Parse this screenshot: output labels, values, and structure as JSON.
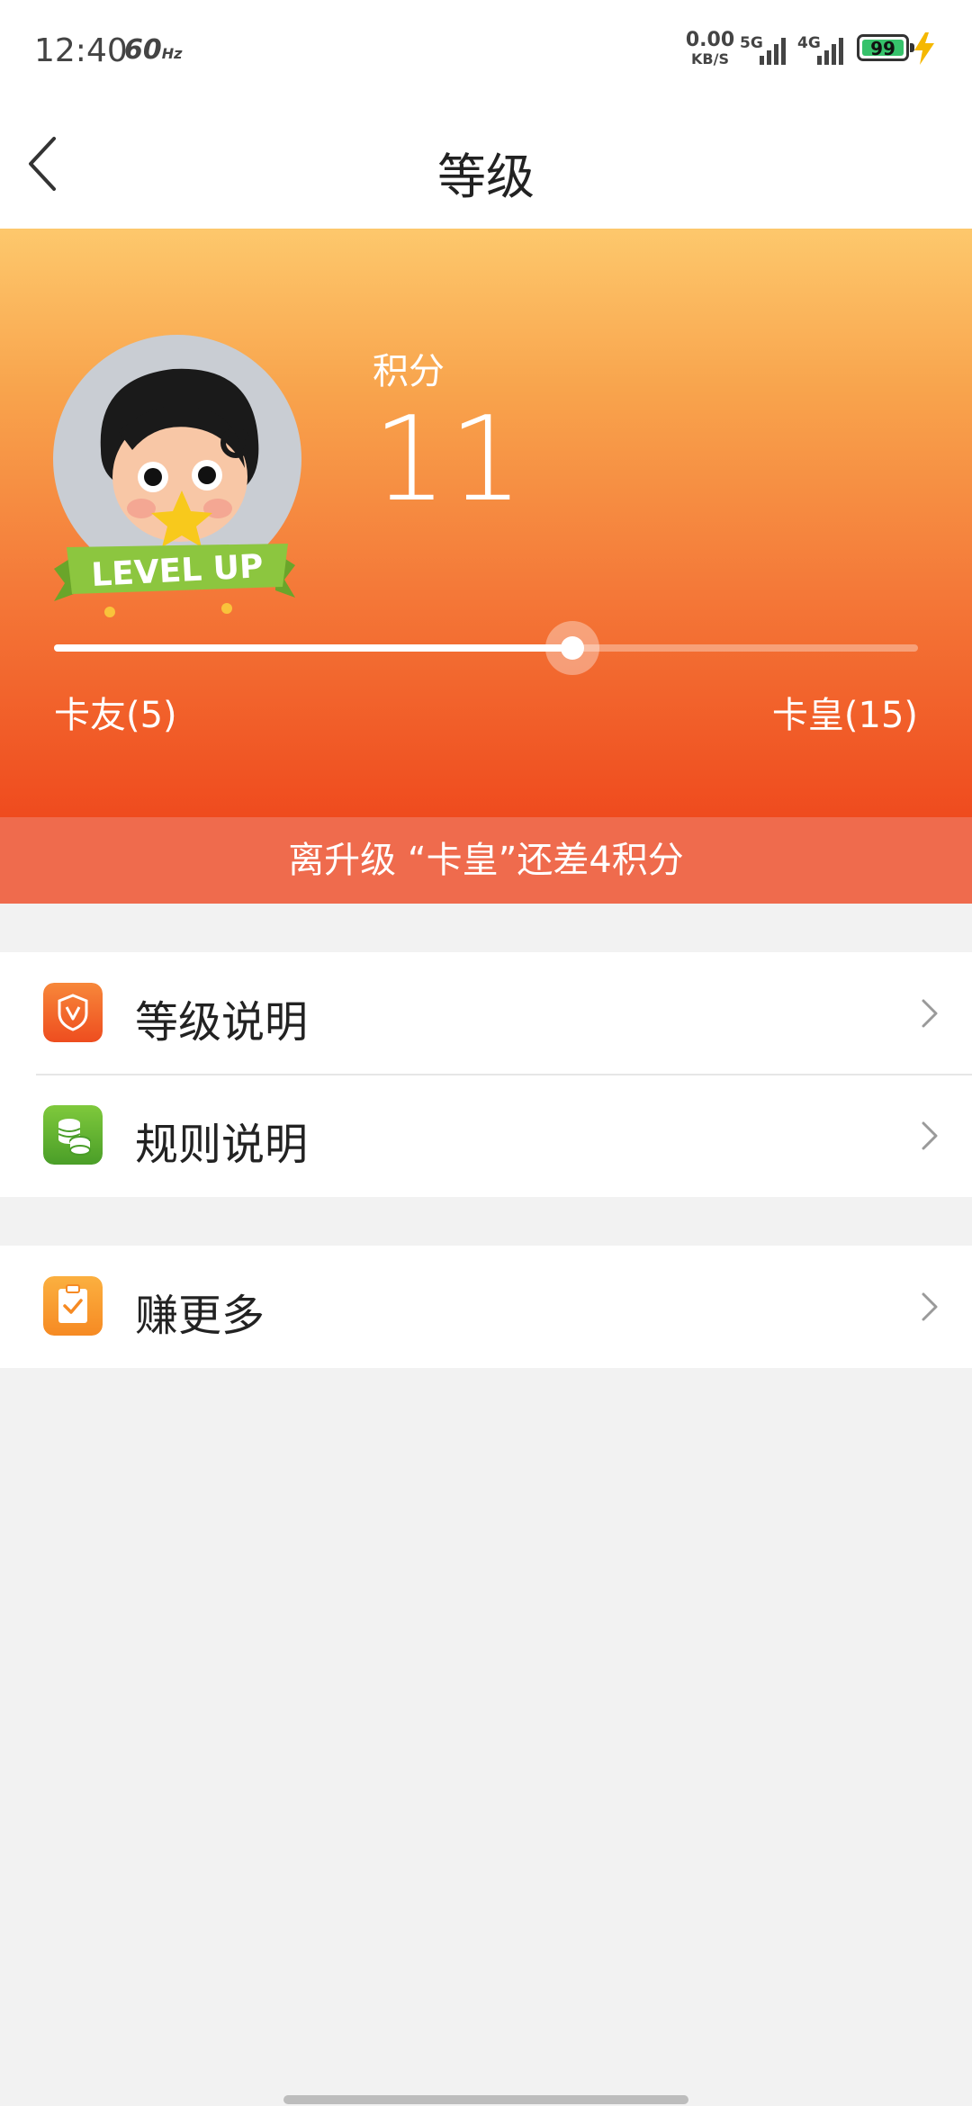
{
  "status_bar": {
    "time": "12:40",
    "refresh_rate": "60",
    "refresh_unit": "Hz",
    "net_speed": "0.00",
    "net_unit": "KB/S",
    "signal1": "5G",
    "signal2": "4G",
    "battery": "99"
  },
  "nav": {
    "title": "等级"
  },
  "hero": {
    "score_label": "积分",
    "score_value": "11",
    "progress_fraction": 0.6,
    "level_left": "卡友(5)",
    "level_right": "卡皇(15)",
    "badge_text": "LEVEL UP"
  },
  "banner": {
    "text": "离升级 “卡皇”还差4积分"
  },
  "menu": {
    "group1": [
      {
        "label": "等级说明",
        "icon": "shield-v-icon",
        "color": "#f15a24"
      },
      {
        "label": "规则说明",
        "icon": "coins-icon",
        "color": "#5db12f"
      }
    ],
    "group2": [
      {
        "label": "赚更多",
        "icon": "clipboard-check-icon",
        "color": "#f8922a"
      }
    ]
  }
}
